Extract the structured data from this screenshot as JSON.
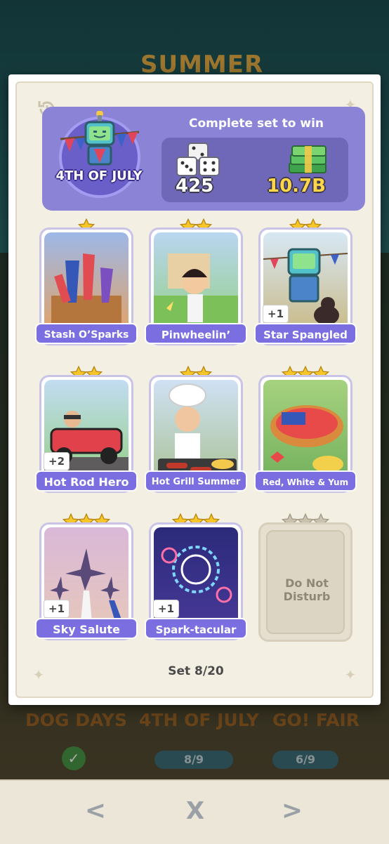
{
  "background": {
    "event_title": "SUMMER",
    "sets": [
      "DOG DAYS",
      "4TH OF JULY",
      "GO! FAIR"
    ],
    "progress": [
      "8/9",
      "6/9"
    ]
  },
  "header": {
    "set_name": "4TH OF JULY",
    "reward_title": "Complete set to win",
    "dice_reward": "425",
    "cash_reward": "10.7B"
  },
  "stickers": [
    {
      "name": "Stash O’Sparks",
      "stars": 1,
      "extra": ""
    },
    {
      "name": "Pinwheelin’",
      "stars": 2,
      "extra": ""
    },
    {
      "name": "Star Spangled",
      "stars": 2,
      "extra": "+1"
    },
    {
      "name": "Hot Rod Hero",
      "stars": 2,
      "extra": "+2"
    },
    {
      "name": "Hot Grill Summer",
      "stars": 2,
      "extra": ""
    },
    {
      "name": "Red, White & Yum",
      "stars": 3,
      "extra": ""
    },
    {
      "name": "Sky Salute",
      "stars": 3,
      "extra": "+1"
    },
    {
      "name": "Spark-tacular",
      "stars": 3,
      "extra": "+1"
    },
    {
      "name": "Do Not Disturb",
      "stars": 3,
      "extra": "",
      "locked": true
    }
  ],
  "set_counter": "Set 8/20",
  "nav": {
    "prev": "<",
    "close": "X",
    "next": ">"
  },
  "colors": {
    "label_purple": "#7b6ee0",
    "header_purple": "#8b84d6",
    "star_gold": "#f7c62b",
    "star_gray": "#c9c2ae"
  }
}
